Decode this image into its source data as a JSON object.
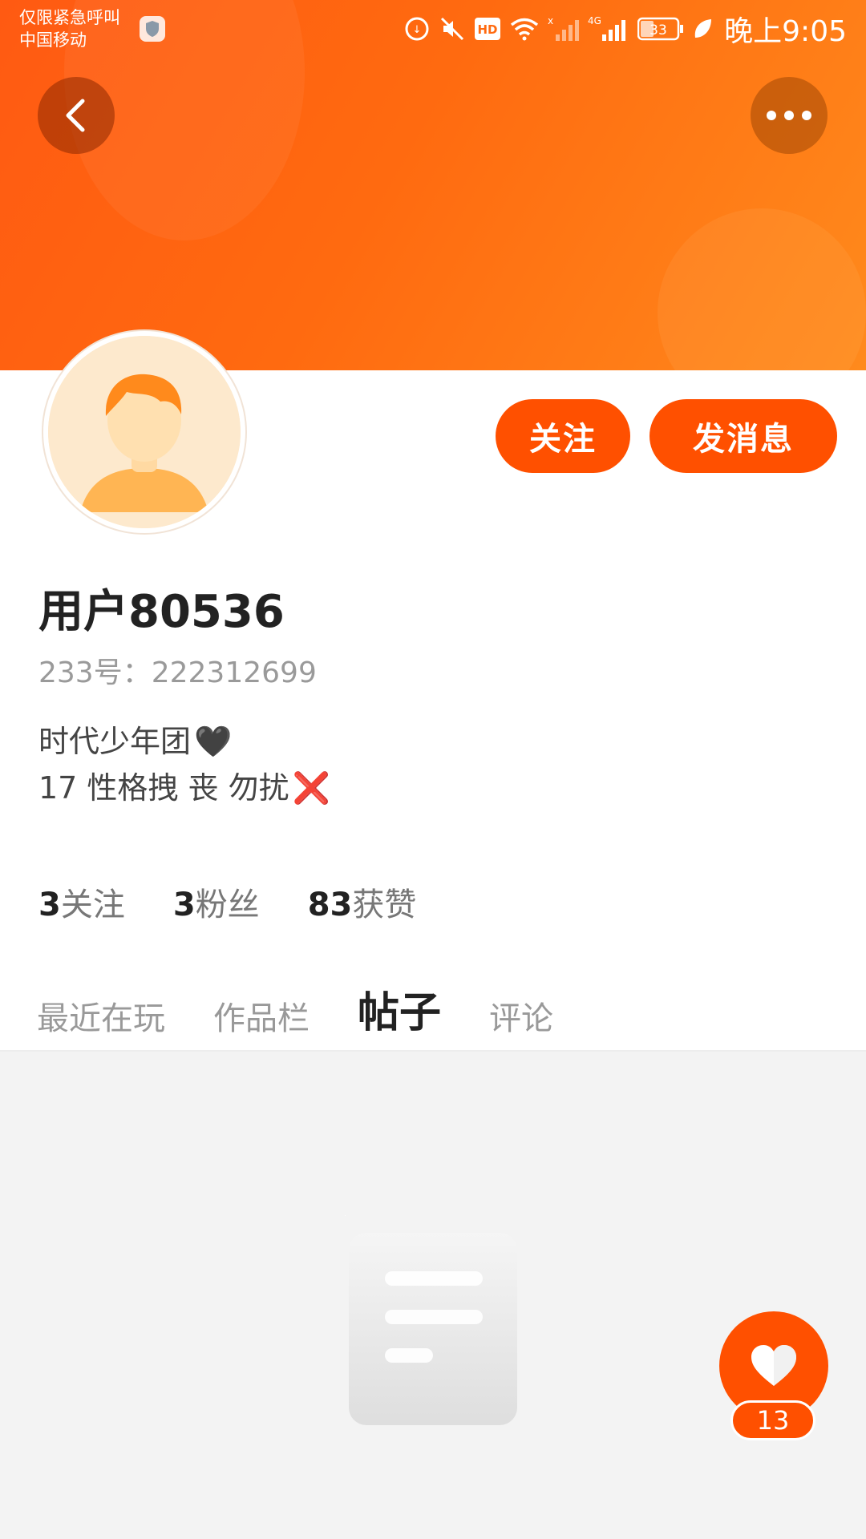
{
  "status_bar": {
    "carrier_line1": "仅限紧急呼叫",
    "carrier_line2": "中国移动",
    "network": "4G",
    "battery": "33",
    "time": "晚上9:05"
  },
  "profile": {
    "username": "用户80536",
    "id_label": "233号：222312699",
    "bio_line1": "时代少年团",
    "bio_line2": "17 性格拽 丧 勿扰",
    "bio_emoji1": "🖤",
    "bio_emoji2": "❌"
  },
  "actions": {
    "follow_label": "关注",
    "message_label": "发消息"
  },
  "stats": [
    {
      "num": "3",
      "label": "关注"
    },
    {
      "num": "3",
      "label": "粉丝"
    },
    {
      "num": "83",
      "label": "获赞"
    }
  ],
  "tabs": [
    {
      "label": "最近在玩"
    },
    {
      "label": "作品栏"
    },
    {
      "label": "帖子"
    },
    {
      "label": "评论"
    }
  ],
  "like": {
    "count": "13"
  },
  "colors": {
    "accent": "#ff5000",
    "header_start": "#ff5a12",
    "header_end": "#ff8a1c",
    "content_bg": "#f3f3f3"
  },
  "icons": [
    "back-arrow-icon",
    "more-dots-icon",
    "heart-icon",
    "shield-icon",
    "wifi-icon",
    "signal-icon",
    "battery-icon",
    "mute-icon",
    "hd-icon",
    "leaf-icon",
    "empty-document-icon"
  ]
}
